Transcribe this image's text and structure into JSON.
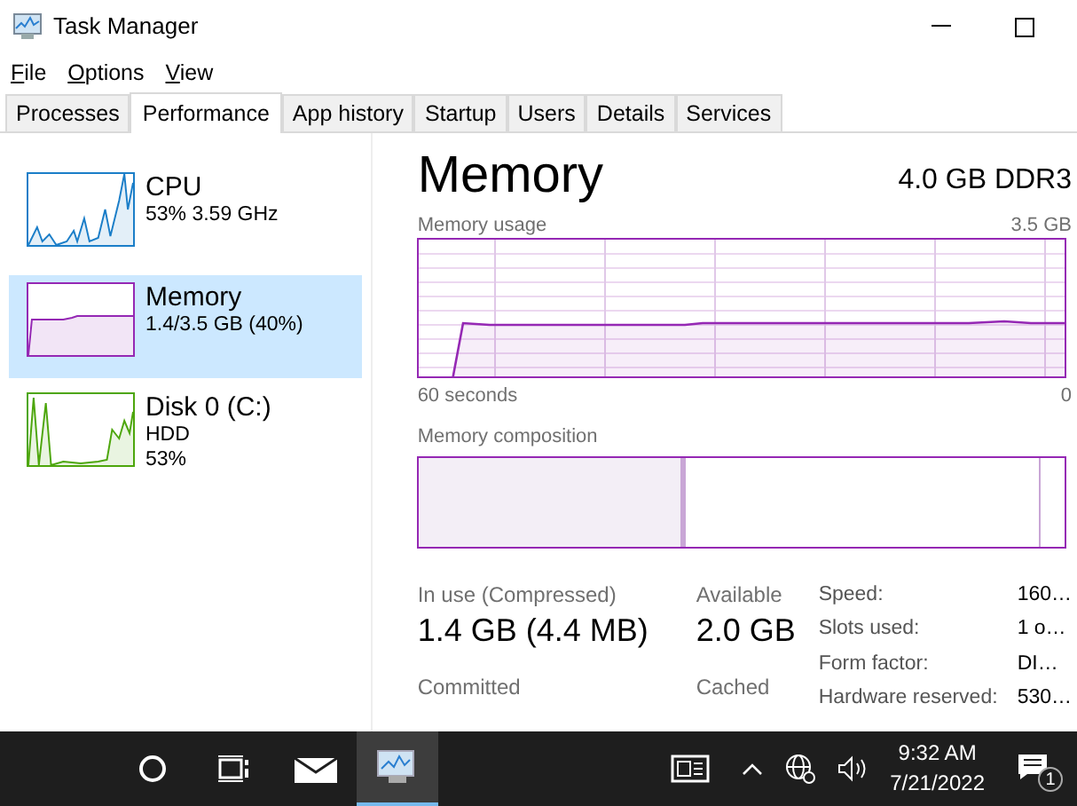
{
  "window": {
    "title": "Task Manager"
  },
  "menu": [
    {
      "label": "File"
    },
    {
      "label": "Options"
    },
    {
      "label": "View"
    }
  ],
  "tabs": [
    {
      "label": "Processes",
      "selected": false
    },
    {
      "label": "Performance",
      "selected": true
    },
    {
      "label": "App history",
      "selected": false
    },
    {
      "label": "Startup",
      "selected": false
    },
    {
      "label": "Users",
      "selected": false
    },
    {
      "label": "Details",
      "selected": false
    },
    {
      "label": "Services",
      "selected": false
    }
  ],
  "sidebar": {
    "items": [
      {
        "kind": "cpu",
        "name": "CPU",
        "details": [
          "53%  3.59 GHz"
        ],
        "selected": false,
        "color": "#1b7ec8"
      },
      {
        "kind": "memory",
        "name": "Memory",
        "details": [
          "1.4/3.5 GB (40%)"
        ],
        "selected": true,
        "color": "#9528b4"
      },
      {
        "kind": "disk",
        "name": "Disk 0 (C:)",
        "details": [
          "HDD",
          "53%"
        ],
        "selected": false,
        "color": "#4da60c"
      }
    ]
  },
  "detail": {
    "title": "Memory",
    "subtitle": "4.0 GB DDR3",
    "usage_chart": {
      "label": "Memory usage",
      "max": "3.5 GB",
      "x_start": "60 seconds",
      "x_end": "0"
    },
    "composition": {
      "label": "Memory composition"
    },
    "stats": [
      {
        "label": "In use (Compressed)",
        "value": "1.4 GB (4.4 MB)"
      },
      {
        "label": "Available",
        "value": "2.0 GB"
      },
      {
        "label": "Committed"
      },
      {
        "label": "Cached"
      }
    ],
    "properties": [
      {
        "label": "Speed:",
        "value": "160…"
      },
      {
        "label": "Slots used:",
        "value": "1 o…"
      },
      {
        "label": "Form factor:",
        "value": "DI…"
      },
      {
        "label": "Hardware reserved:",
        "value": "530…"
      }
    ]
  },
  "taskbar": {
    "time": "9:32 AM",
    "date": "7/21/2022",
    "notifications": "1"
  }
}
